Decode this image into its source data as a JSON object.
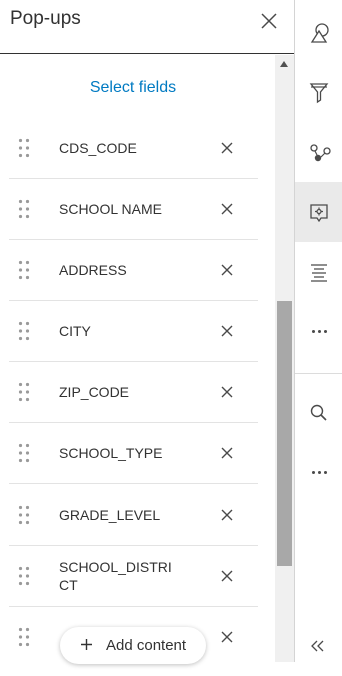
{
  "panel": {
    "title": "Pop-ups",
    "select_fields_label": "Select fields",
    "add_content_label": "Add content"
  },
  "fields": [
    {
      "label": "CDS_CODE"
    },
    {
      "label": "SCHOOL NAME"
    },
    {
      "label": "ADDRESS"
    },
    {
      "label": "CITY"
    },
    {
      "label": "ZIP_CODE"
    },
    {
      "label": "SCHOOL_TYPE"
    },
    {
      "label": "GRADE_LEVEL"
    },
    {
      "label": "SCHOOL_DISTRI\nCT"
    },
    {
      "label": ""
    }
  ],
  "rail": {
    "items": [
      "layers-shapes-icon",
      "filter-icon",
      "analysis-nodes-icon",
      "popup-config-icon",
      "text-align-icon",
      "more-icon",
      "search-icon",
      "more-icon",
      "collapse-icon"
    ],
    "active": "popup-config-icon"
  },
  "colors": {
    "accent": "#007ac2",
    "text": "#323232",
    "scroll_thumb": "#a8a8a8"
  }
}
